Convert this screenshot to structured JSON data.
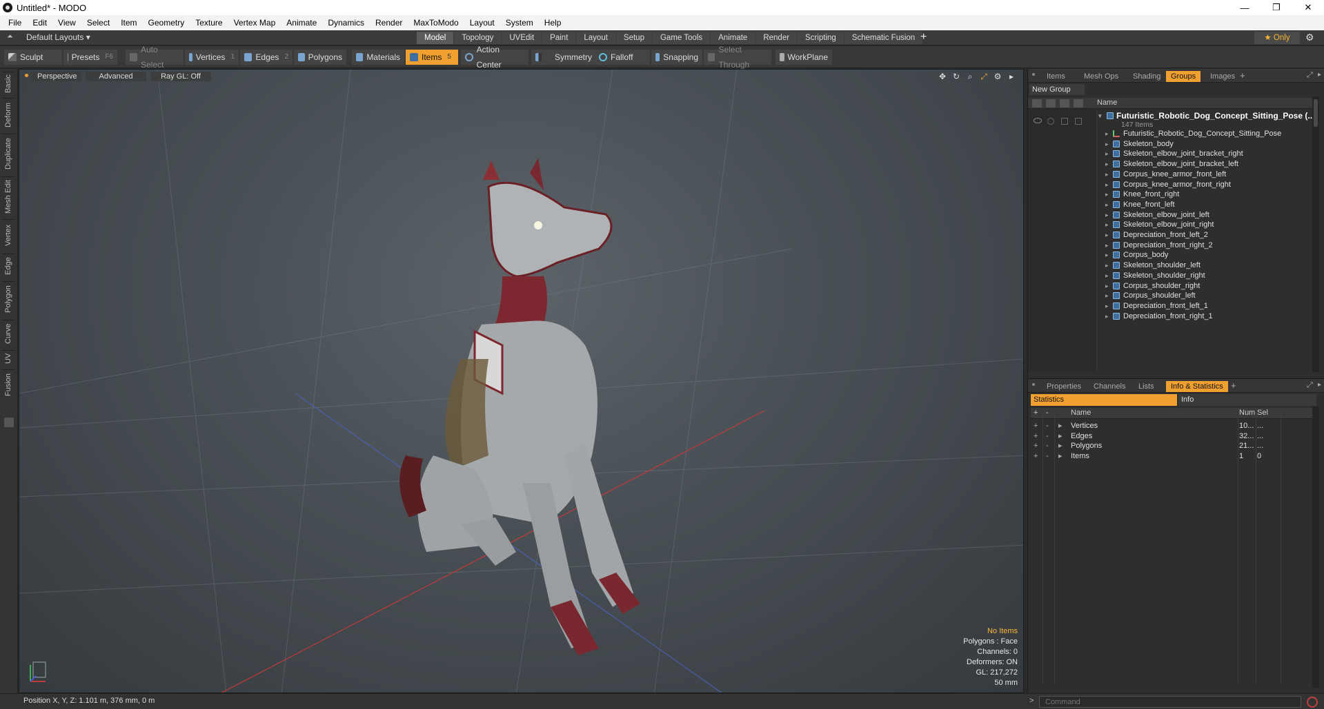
{
  "window": {
    "title": "Untitled* - MODO",
    "minimize": "—",
    "maximize": "❐",
    "close": "✕"
  },
  "menu": [
    "File",
    "Edit",
    "View",
    "Select",
    "Item",
    "Geometry",
    "Texture",
    "Vertex Map",
    "Animate",
    "Dynamics",
    "Render",
    "MaxToModo",
    "Layout",
    "System",
    "Help"
  ],
  "layoutbar": {
    "layout_select": "Default Layouts ▾",
    "tabs": [
      "Model",
      "Topology",
      "UVEdit",
      "Paint",
      "Layout",
      "Setup",
      "Game Tools",
      "Animate",
      "Render",
      "Scripting",
      "Schematic Fusion"
    ],
    "active_tab": "Model",
    "plus": "+",
    "only": "★ Only"
  },
  "toolbar": {
    "sculpt": "Sculpt",
    "presets": "Presets",
    "presets_key": "F6",
    "auto_select": "Auto Select",
    "vertices": "Vertices",
    "vertices_key": "1",
    "edges": "Edges",
    "edges_key": "2",
    "polygons": "Polygons",
    "materials": "Materials",
    "items": "Items",
    "items_key": "5",
    "action_center": "Action Center",
    "symmetry": "Symmetry",
    "falloff": "Falloff",
    "snapping": "Snapping",
    "select_through": "Select Through",
    "workplane": "WorkPlane"
  },
  "lefttabs": [
    "Basic",
    "Deform",
    "Duplicate",
    "Mesh Edit",
    "Vertex",
    "Edge",
    "Polygon",
    "Curve",
    "UV",
    "Fusion"
  ],
  "viewport": {
    "view": "Perspective",
    "shading": "Advanced",
    "raygl": "Ray GL: Off",
    "info": {
      "no_items": "No Items",
      "polygons": "Polygons : Face",
      "channels": "Channels: 0",
      "deformers": "Deformers: ON",
      "gl": "GL: 217,272",
      "focal": "50 mm"
    }
  },
  "groups_panel": {
    "tabs": [
      "Items",
      "Mesh Ops",
      "Shading",
      "Groups",
      "Images"
    ],
    "active_tab": "Groups",
    "new_group": "New Group",
    "name_header": "Name",
    "root": "Futuristic_Robotic_Dog_Concept_Sitting_Pose (...",
    "root_count": "147 Items",
    "items": [
      "Futuristic_Robotic_Dog_Concept_Sitting_Pose",
      "Skeleton_body",
      "Skeleton_elbow_joint_bracket_right",
      "Skeleton_elbow_joint_bracket_left",
      "Corpus_knee_armor_front_left",
      "Corpus_knee_armor_front_right",
      "Knee_front_right",
      "Knee_front_left",
      "Skeleton_elbow_joint_left",
      "Skeleton_elbow_joint_right",
      "Depreciation_front_left_2",
      "Depreciation_front_right_2",
      "Corpus_body",
      "Skeleton_shoulder_left",
      "Skeleton_shoulder_right",
      "Corpus_shoulder_right",
      "Corpus_shoulder_left",
      "Depreciation_front_left_1",
      "Depreciation_front_right_1"
    ]
  },
  "stats_panel": {
    "tabs": [
      "Properties",
      "Channels",
      "Lists",
      "Info & Statistics"
    ],
    "active_tab": "Info & Statistics",
    "sub_tabs": {
      "statistics": "Statistics",
      "info": "Info"
    },
    "headers": {
      "name": "Name",
      "num": "Num",
      "sel": "Sel"
    },
    "rows": [
      {
        "name": "Vertices",
        "num": "10...",
        "sel": "..."
      },
      {
        "name": "Edges",
        "num": "32...",
        "sel": "..."
      },
      {
        "name": "Polygons",
        "num": "21...",
        "sel": "..."
      },
      {
        "name": "Items",
        "num": "1",
        "sel": "0"
      }
    ]
  },
  "statusbar": {
    "position": "Position X, Y, Z:   1.101 m, 376 mm, 0 m",
    "command_placeholder": "Command"
  },
  "colors": {
    "accent": "#f0a030",
    "warn": "#ffb636"
  }
}
